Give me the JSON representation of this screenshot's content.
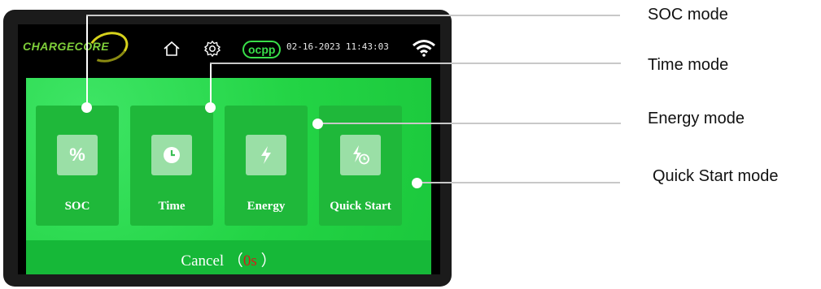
{
  "header": {
    "logo_text": "CHARGECORE",
    "ocpp_label": "ocpp",
    "datetime": "02-16-2023 11:43:03"
  },
  "modes": [
    {
      "label": "SOC",
      "icon": "percent-icon",
      "glyph": "%"
    },
    {
      "label": "Time",
      "icon": "clock-icon"
    },
    {
      "label": "Energy",
      "icon": "lightning-icon"
    },
    {
      "label": "Quick Start",
      "icon": "quick-start-icon"
    }
  ],
  "cancel": {
    "label": "Cancel （",
    "countdown": "0s",
    "close_paren": " ）"
  },
  "callouts": {
    "soc": "SOC mode",
    "time": "Time mode",
    "energy": "Energy mode",
    "quick_start": "Quick Start mode"
  },
  "colors": {
    "screen_green": "#22d640",
    "tile_green": "#1fb83a",
    "ocpp_green": "#39e04a",
    "countdown_red": "#d61a1a"
  }
}
